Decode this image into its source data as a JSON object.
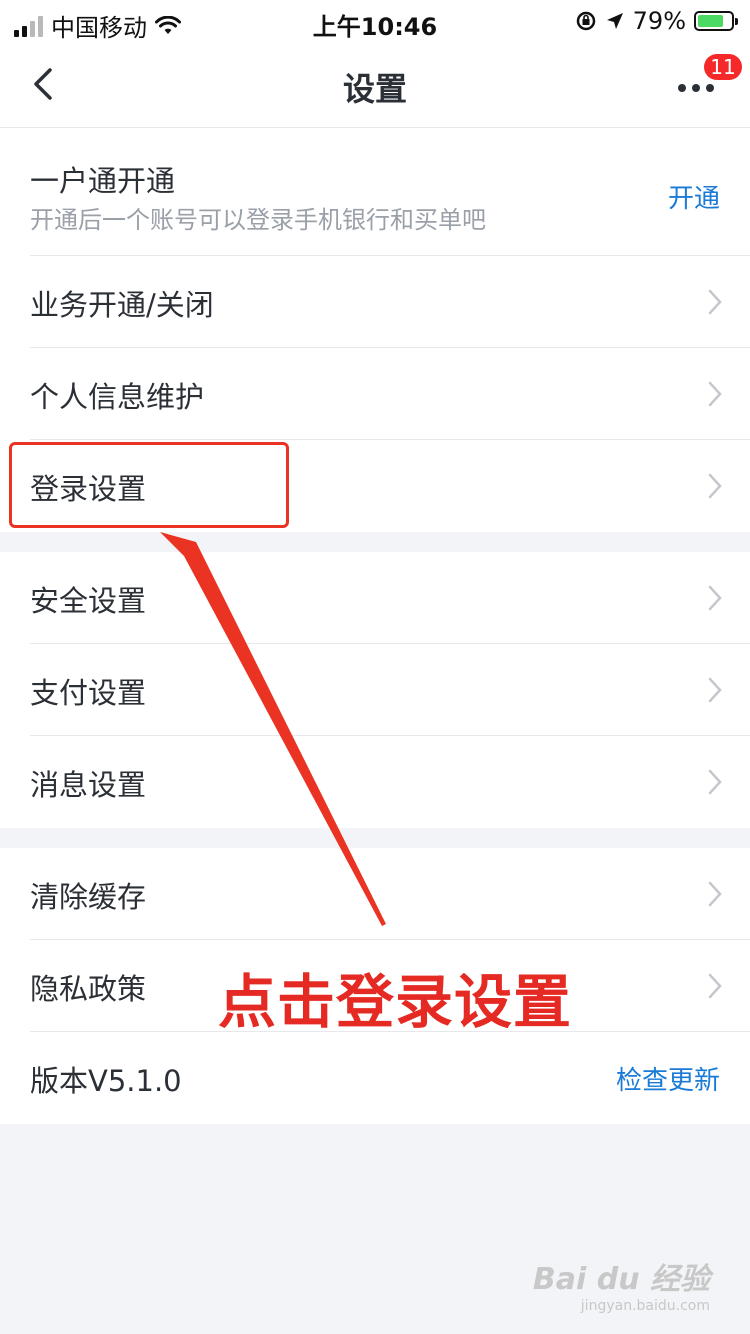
{
  "status_bar": {
    "carrier": "中国移动",
    "time": "上午10:46",
    "battery_percent": "79%",
    "battery_level": 0.79
  },
  "nav": {
    "title": "设置",
    "badge_count": "11"
  },
  "groups": [
    {
      "items": [
        {
          "label": "一户通开通",
          "sub": "开通后一个账号可以登录手机银行和买单吧",
          "action": "开通"
        },
        {
          "label": "业务开通/关闭"
        },
        {
          "label": "个人信息维护"
        },
        {
          "label": "登录设置"
        }
      ]
    },
    {
      "items": [
        {
          "label": "安全设置"
        },
        {
          "label": "支付设置"
        },
        {
          "label": "消息设置"
        }
      ]
    },
    {
      "items": [
        {
          "label": "清除缓存"
        },
        {
          "label": "隐私政策"
        },
        {
          "label": "版本V5.1.0",
          "action": "检查更新"
        }
      ]
    }
  ],
  "annotation": {
    "text": "点击登录设置",
    "color": "#e52a24"
  },
  "colors": {
    "accent": "#1a7bd6",
    "badge": "#f5282a",
    "background": "#f2f4f7"
  },
  "watermark": {
    "logo": "Bai du 经验",
    "url": "jingyan.baidu.com"
  }
}
